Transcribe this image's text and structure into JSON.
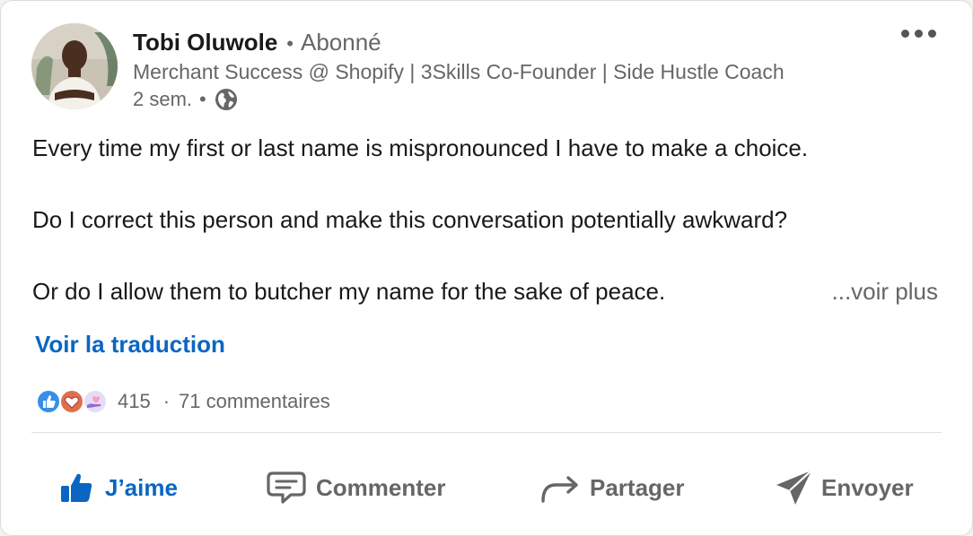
{
  "post": {
    "author": {
      "name": "Tobi Oluwole",
      "follow_status": "Abonné",
      "headline": "Merchant Success @ Shopify | 3Skills Co-Founder | Side Hustle Coach",
      "time_ago": "2 sem.",
      "visibility_icon": "globe-icon"
    },
    "body": {
      "lines": [
        "Every time my first or last name is mispronounced I have to make a choice.",
        "Do I correct this person and make this conversation potentially awkward?",
        "Or do I allow them to butcher my name for the sake of peace."
      ],
      "see_more": "...voir plus"
    },
    "translate_label": "Voir la traduction",
    "social": {
      "reaction_icons": [
        "like-reaction-icon",
        "love-reaction-icon",
        "support-reaction-icon"
      ],
      "reaction_count": "415",
      "separator": "·",
      "comments": "71 commentaires"
    },
    "actions": {
      "like": "J’aime",
      "comment": "Commenter",
      "share": "Partager",
      "send": "Envoyer"
    }
  },
  "colors": {
    "accent": "#0a66c2",
    "text_secondary": "#666666",
    "text_primary": "#191919",
    "love": "#df704d",
    "support": "#a872e8"
  }
}
